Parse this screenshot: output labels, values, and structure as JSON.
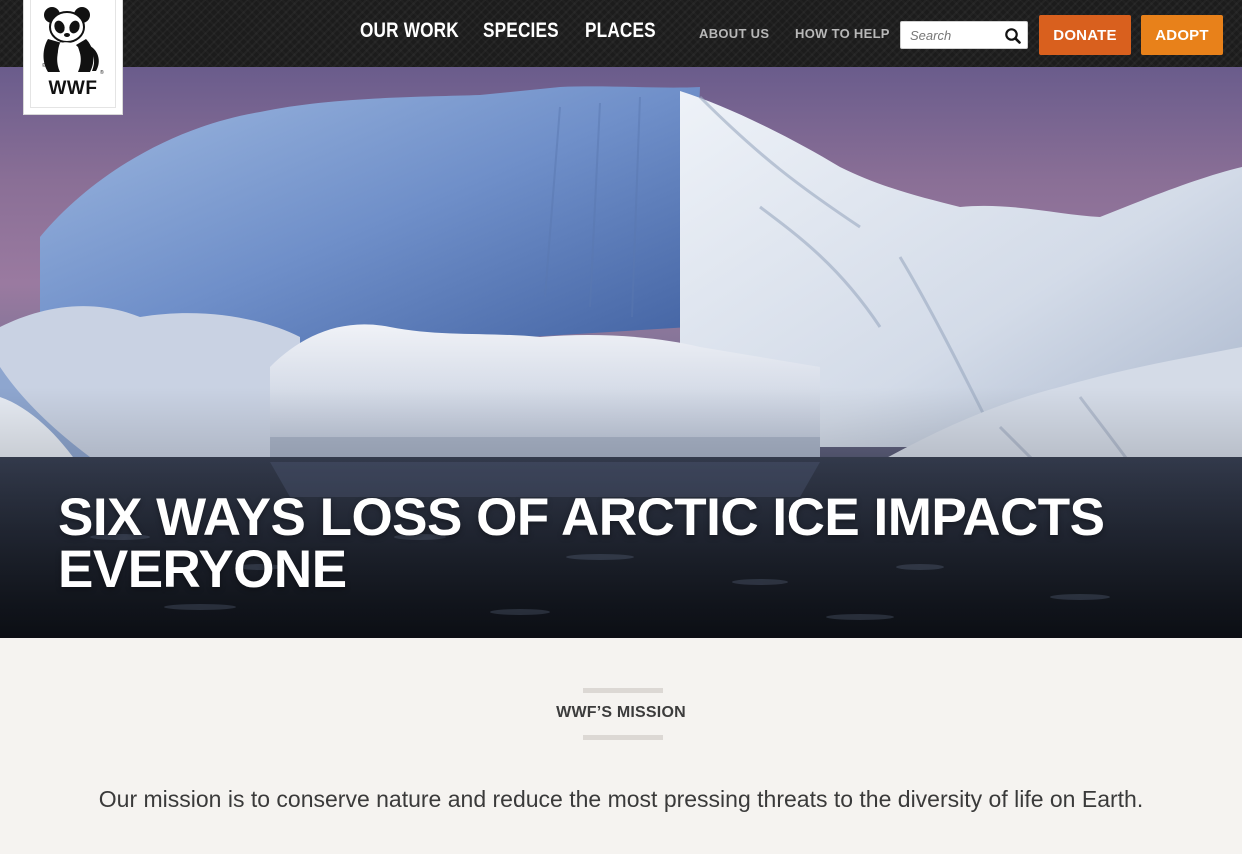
{
  "logo": {
    "text": "WWF",
    "icon": "panda-icon"
  },
  "nav": {
    "primary": [
      "OUR WORK",
      "SPECIES",
      "PLACES"
    ],
    "secondary": [
      "ABOUT US",
      "HOW TO HELP"
    ]
  },
  "search": {
    "placeholder": "Search",
    "value": "",
    "icon": "search-icon"
  },
  "buttons": {
    "donate": "DONATE",
    "adopt": "ADOPT"
  },
  "hero": {
    "title": "SIX WAYS LOSS OF ARCTIC ICE IMPACTS EVERYONE"
  },
  "mission": {
    "heading": "WWF’S MISSION",
    "text": "Our mission is to conserve nature and reduce the most pressing threats to the diversity of life on Earth."
  },
  "colors": {
    "header_bg": "#1c1c1c",
    "donate": "#d9601e",
    "adopt": "#e8811a",
    "page_bg": "#f5f3f0"
  }
}
